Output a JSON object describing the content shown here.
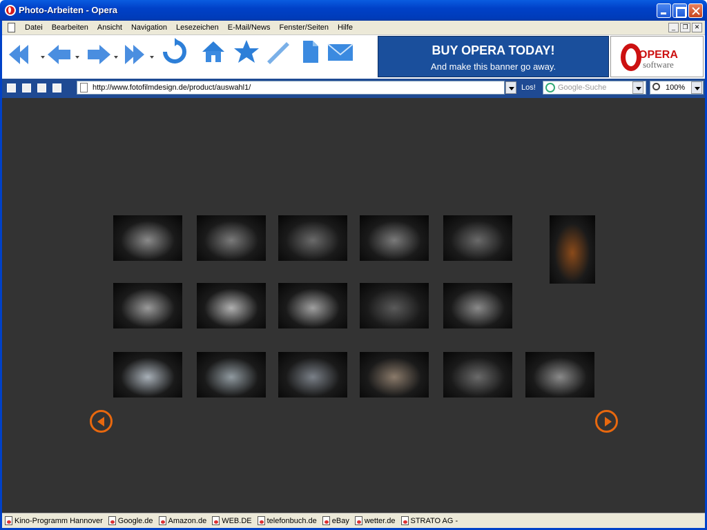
{
  "window": {
    "title": "Photo-Arbeiten - Opera"
  },
  "menu": [
    "Datei",
    "Bearbeiten",
    "Ansicht",
    "Navigation",
    "Lesezeichen",
    "E-Mail/News",
    "Fenster/Seiten",
    "Hilfe"
  ],
  "banner": {
    "headline": "BUY OPERA TODAY!",
    "subline": "And make this banner go away.",
    "logo_main": "OPERA",
    "logo_sub": "software"
  },
  "address": {
    "url": "http://www.fotofilmdesign.de/product/auswahl1/",
    "go_label": "Los!",
    "search_placeholder": "Google-Suche",
    "zoom": "100%"
  },
  "thumbnails": [
    {
      "row": 1,
      "subject": "shifter",
      "tone": "#8a8a8a"
    },
    {
      "row": 1,
      "subject": "shifter",
      "tone": "#7a7a7a"
    },
    {
      "row": 1,
      "subject": "shifter",
      "tone": "#6a6a6a"
    },
    {
      "row": 1,
      "subject": "shifter",
      "tone": "#7a7a7a"
    },
    {
      "row": 1,
      "subject": "shifter",
      "tone": "#6a6a6a"
    },
    {
      "row": 1,
      "subject": "bottle",
      "tone": "#8a4a1a"
    },
    {
      "row": 2,
      "subject": "clock",
      "tone": "#9a9a9a"
    },
    {
      "row": 2,
      "subject": "clock",
      "tone": "#b0b0b0"
    },
    {
      "row": 2,
      "subject": "clock",
      "tone": "#a0a0a0"
    },
    {
      "row": 2,
      "subject": "phone",
      "tone": "#5a5a5a"
    },
    {
      "row": 2,
      "subject": "device",
      "tone": "#8a8a8a"
    },
    {
      "row": 3,
      "subject": "calculator",
      "tone": "#a8b0b8"
    },
    {
      "row": 3,
      "subject": "calculator",
      "tone": "#909aa0"
    },
    {
      "row": 3,
      "subject": "calculator",
      "tone": "#7a8088"
    },
    {
      "row": 3,
      "subject": "clock",
      "tone": "#8a7a6a"
    },
    {
      "row": 3,
      "subject": "sculpture",
      "tone": "#6a6a6a"
    },
    {
      "row": 3,
      "subject": "sculpture",
      "tone": "#8a8a8a"
    }
  ],
  "nav": {
    "accent": "#e8680e",
    "prev_icon": "arrow-left-circle-icon",
    "next_icon": "arrow-right-circle-icon"
  },
  "bookmarks": [
    "Kino-Programm  Hannover",
    "Google.de",
    "Amazon.de",
    "WEB.DE",
    "telefonbuch.de",
    "eBay",
    "wetter.de",
    "STRATO AG -"
  ]
}
